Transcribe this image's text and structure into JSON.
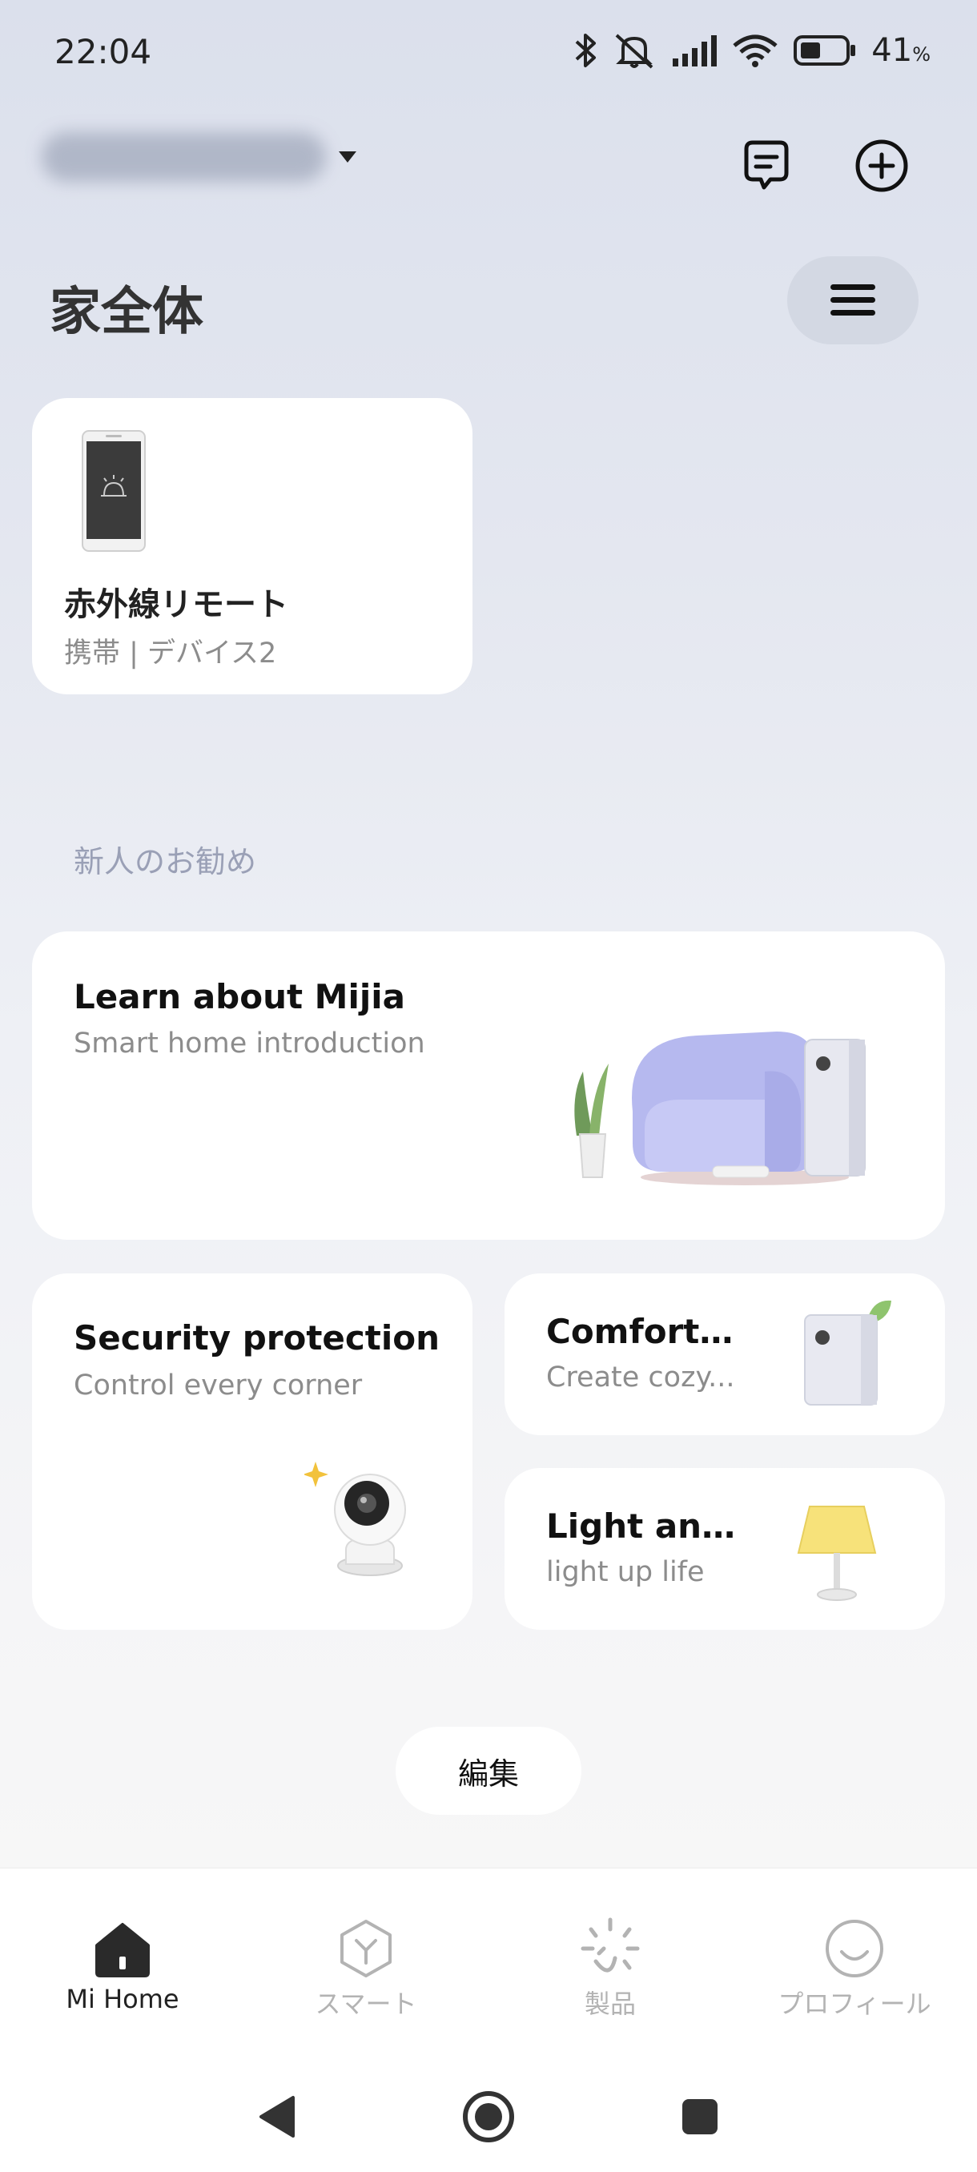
{
  "status_bar": {
    "time": "22:04",
    "battery_percent": "41",
    "battery_unit": "%",
    "icons": [
      "bluetooth-icon",
      "mute-icon",
      "signal-icon",
      "wifi-icon",
      "battery-icon"
    ]
  },
  "header": {
    "icons": [
      "message-icon",
      "add-icon"
    ]
  },
  "page": {
    "title": "家全体",
    "menu_icon": "menu-icon"
  },
  "device": {
    "name": "赤外線リモート",
    "subtitle": "携帯 | デバイス2"
  },
  "recommend": {
    "section_label": "新人のお勧め",
    "learn": {
      "title": "Learn about Mijia",
      "subtitle": "Smart home introduction"
    },
    "security": {
      "title": "Security protection",
      "subtitle": "Control every corner"
    },
    "comfort": {
      "title": "Comforta...",
      "subtitle": "Create cozy..."
    },
    "light": {
      "title": "Light and i...",
      "subtitle": "light up life"
    }
  },
  "edit_label": "編集",
  "bottom_nav": [
    {
      "label": "Mi Home",
      "icon": "home-icon",
      "active": true
    },
    {
      "label": "スマート",
      "icon": "smart-icon",
      "active": false
    },
    {
      "label": "製品",
      "icon": "products-icon",
      "active": false
    },
    {
      "label": "プロフィール",
      "icon": "profile-icon",
      "active": false
    }
  ],
  "system_nav": [
    "back-icon",
    "home-circle-icon",
    "recents-icon"
  ]
}
